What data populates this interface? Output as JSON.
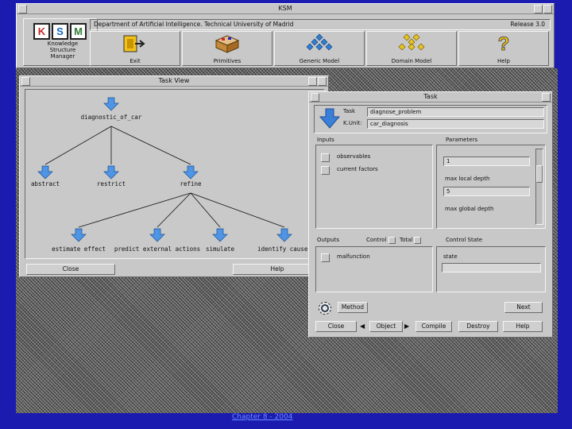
{
  "main_window": {
    "title": "KSM",
    "header_left": "Department of Artificial Intelligence. Technical University of Madrid",
    "header_right": "Release 3.0",
    "logo_letters": [
      "K",
      "S",
      "M"
    ],
    "logo_subtitle": [
      "Knowledge",
      "Structure",
      "Manager"
    ],
    "tools": [
      {
        "label": "Exit",
        "icon": "exit-door-icon"
      },
      {
        "label": "Primitives",
        "icon": "primitives-box-icon"
      },
      {
        "label": "Generic Model",
        "icon": "generic-model-icon"
      },
      {
        "label": "Domain Model",
        "icon": "domain-model-icon"
      },
      {
        "label": "Help",
        "icon": "help-question-icon"
      }
    ]
  },
  "task_view": {
    "title": "Task View",
    "nodes": [
      "diagnostic_of_car",
      "abstract",
      "restrict",
      "refine",
      "estimate effect",
      "predict external actions",
      "simulate",
      "identify causes"
    ],
    "close_label": "Close",
    "help_label": "Help"
  },
  "task_dialog": {
    "title": "Task",
    "task_label": "Task",
    "task_value": "diagnose_problem",
    "kunit_label": "K.Unit:",
    "kunit_value": "car_diagnosis",
    "inputs_label": "Inputs",
    "parameters_label": "Parameters",
    "inputs": [
      "observables",
      "current factors"
    ],
    "param_value_1": "1",
    "param_label_2": "max local depth",
    "param_value_2": "5",
    "param_label_3": "max global depth",
    "outputs_label": "Outputs",
    "control_label": "Control",
    "total_label": "Total",
    "control_state_label": "Control State",
    "outputs": [
      "malfunction"
    ],
    "state_label": "state",
    "method_label": "Method",
    "next_label": "Next",
    "buttons": [
      "Close",
      "Object",
      "Compile",
      "Destroy",
      "Help"
    ]
  },
  "footer_link": "Chapter 8 - 2004",
  "colors": {
    "desktop": "#1b1bb0",
    "window": "#c8c8c8",
    "arrow_blue": "#3a7fd8"
  }
}
